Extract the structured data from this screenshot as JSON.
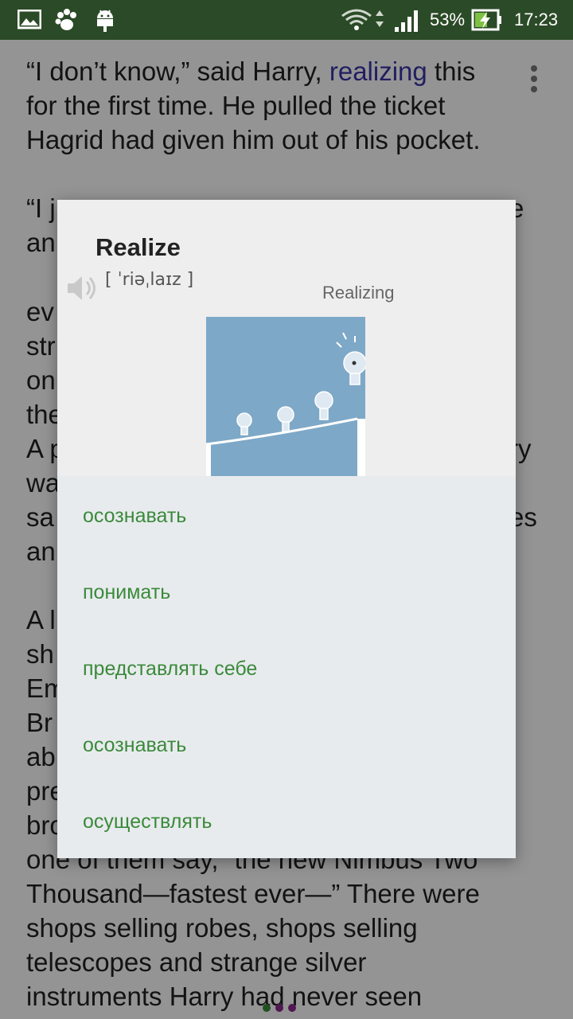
{
  "status_bar": {
    "battery": "53%",
    "time": "17:23",
    "icons": [
      "gallery-icon",
      "paw-icon",
      "android-icon",
      "wifi-icon",
      "signal-icon",
      "battery-icon"
    ]
  },
  "book": {
    "lines": [
      [
        "“I don’t know,” said Harry, ",
        "realizing",
        " this"
      ],
      "for the first time. He pulled the ticket",
      "Hagrid had given him out of his pocket.",
      "",
      "“I j",
      "an",
      "",
      " ev",
      "str",
      "on",
      "the",
      "A p",
      "wa",
      "sa",
      "an",
      "",
      "A l",
      "sh",
      "Em",
      "Br",
      "ab",
      "pre",
      "bro",
      "one of them say, “the new Nimbus Two",
      "Thousand—fastest ever—” There were",
      "shops selling robes, shops selling",
      "telescopes and strange silver",
      "instruments Harry had never seen"
    ],
    "right_fragments": [
      "e",
      "ry",
      "es"
    ],
    "highlight_color": "#3a35a8"
  },
  "dialog": {
    "word": "Realize",
    "transcription": "[ ˈriəˌlaɪz ]",
    "image_caption": "Realizing",
    "translations": [
      "осознавать",
      "понимать",
      "представлять себе",
      "осознавать",
      "осуществлять"
    ],
    "translation_color": "#3a8a3a"
  },
  "page_dots_colors": [
    "#3a8a3a",
    "#8a2a8a",
    "#8a2a8a"
  ]
}
